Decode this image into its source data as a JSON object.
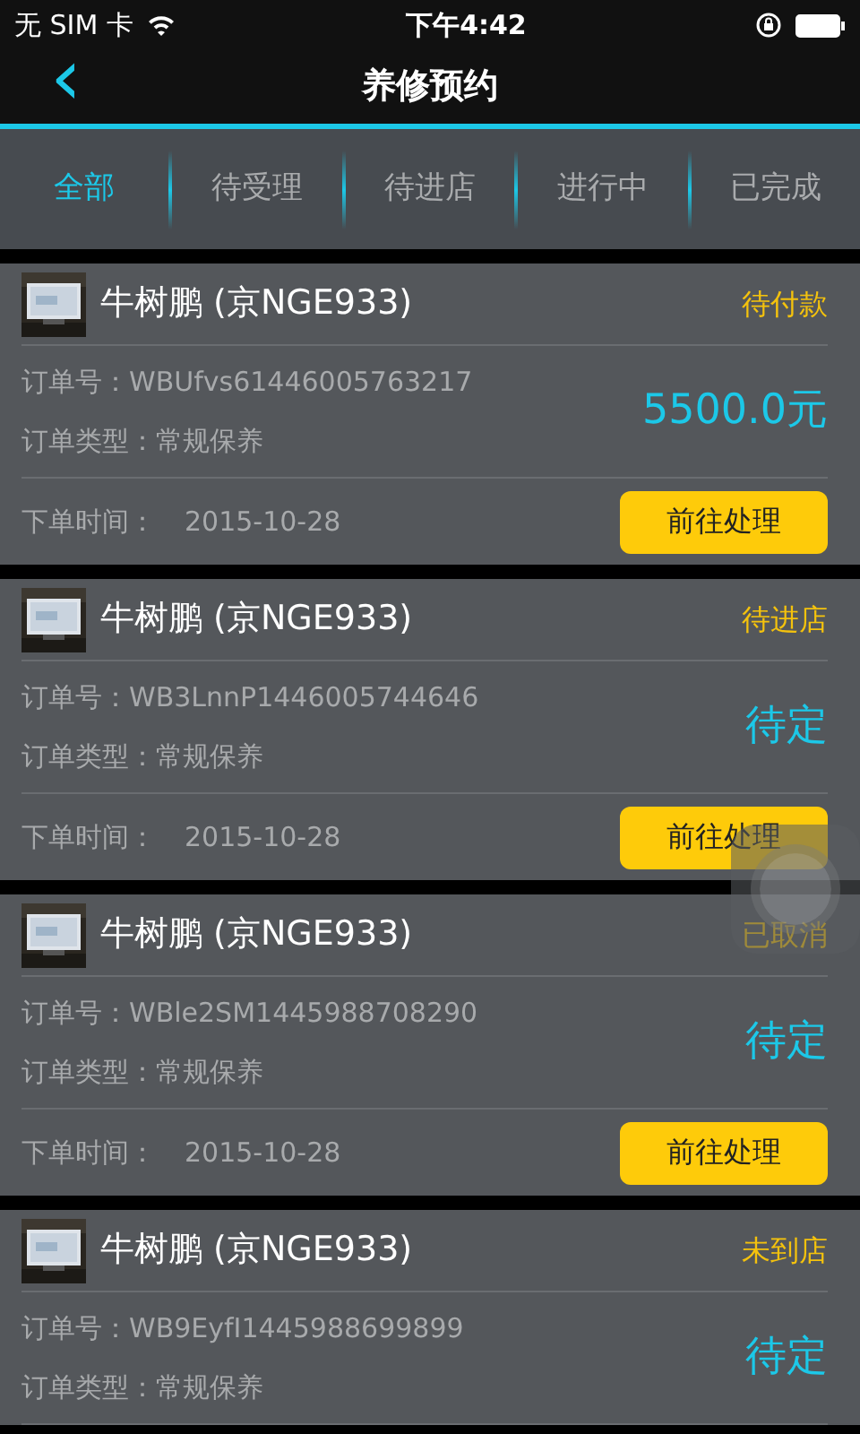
{
  "status_bar": {
    "carrier": "无 SIM 卡",
    "time": "下午4:42"
  },
  "header": {
    "back": "‹",
    "title": "养修预约"
  },
  "tabs": [
    {
      "label": "全部",
      "selected": true
    },
    {
      "label": "待受理",
      "selected": false
    },
    {
      "label": "待进店",
      "selected": false
    },
    {
      "label": "进行中",
      "selected": false
    },
    {
      "label": "已完成",
      "selected": false
    }
  ],
  "orders": [
    {
      "name": "牛树鹏 (京NGE933)",
      "status": "待付款",
      "order_no_label": "订单号：",
      "order_no": "WBUfvs61446005763217",
      "type_label": "订单类型：",
      "type": "常规保养",
      "amount": "5500.0元",
      "time_label": "下单时间：",
      "time": "2015-10-28",
      "action": "前往处理"
    },
    {
      "name": "牛树鹏 (京NGE933)",
      "status": "待进店",
      "order_no_label": "订单号：",
      "order_no": "WB3LnnP1446005744646",
      "type_label": "订单类型：",
      "type": "常规保养",
      "amount": "待定",
      "time_label": "下单时间：",
      "time": "2015-10-28",
      "action": "前往处理"
    },
    {
      "name": "牛树鹏 (京NGE933)",
      "status": "已取消",
      "order_no_label": "订单号：",
      "order_no": "WBle2SM1445988708290",
      "type_label": "订单类型：",
      "type": "常规保养",
      "amount": "待定",
      "time_label": "下单时间：",
      "time": "2015-10-28",
      "action": "前往处理"
    },
    {
      "name": "牛树鹏 (京NGE933)",
      "status": "未到店",
      "order_no_label": "订单号：",
      "order_no": "WB9EyfI1445988699899",
      "type_label": "订单类型：",
      "type": "常规保养",
      "amount": "待定"
    }
  ]
}
